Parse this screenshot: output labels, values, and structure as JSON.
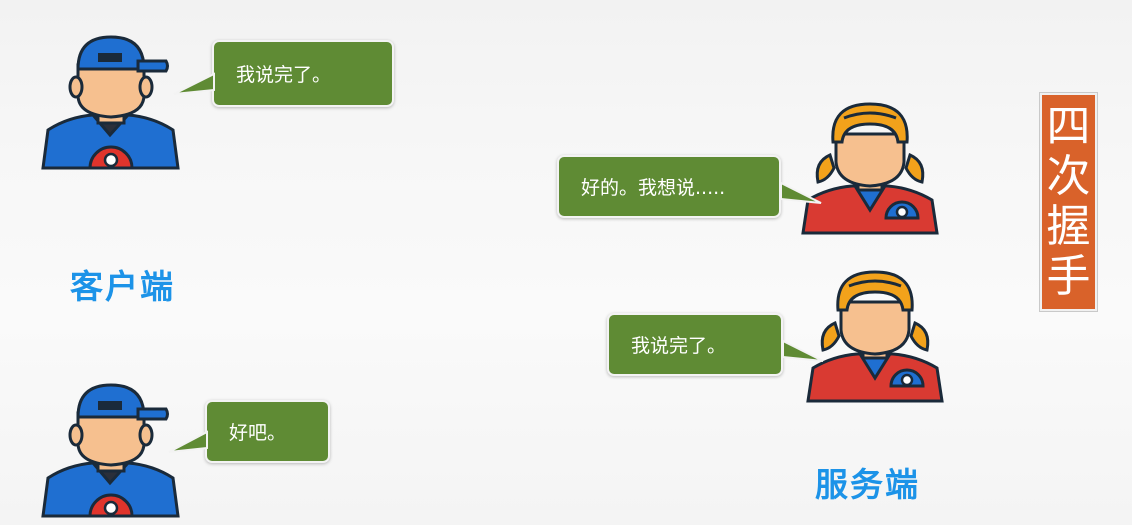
{
  "client": {
    "label": "客户端",
    "bubble_1": "我说完了。",
    "bubble_2": "好吧。"
  },
  "server": {
    "label": "服务端",
    "bubble_1": "好的。我想说.....",
    "bubble_2": "我说完了。"
  },
  "badge": {
    "chars": [
      "四",
      "次",
      "握",
      "手"
    ]
  },
  "colors": {
    "bubble": "#5f8b34",
    "label": "#1c93e8",
    "badge": "#d9622a",
    "client_shirt": "#1f6fd1",
    "server_shirt": "#d93a32",
    "server_hair": "#f2a21b",
    "skin": "#f6c08f"
  }
}
